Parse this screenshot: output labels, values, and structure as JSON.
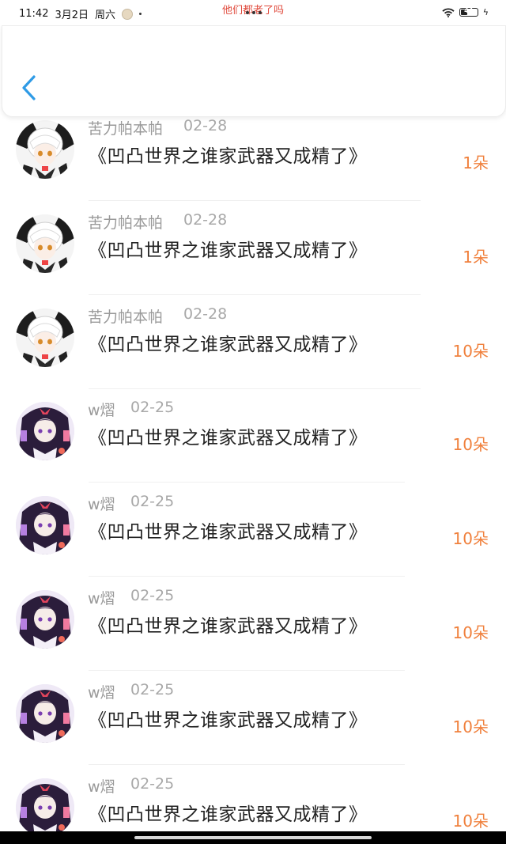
{
  "status_bar": {
    "time": "11:42",
    "date": "3月2日",
    "weekday": "周六",
    "notification_text": "他们都老了吗",
    "battery_level": "44"
  },
  "header": {
    "back_icon": "chevron-left-icon"
  },
  "items": [
    {
      "user": "苦力帕本帕",
      "date": "02-28",
      "title": "《凹凸世界之谁家武器又成精了》",
      "count": "1朵",
      "avatar": "white-hair"
    },
    {
      "user": "苦力帕本帕",
      "date": "02-28",
      "title": "《凹凸世界之谁家武器又成精了》",
      "count": "1朵",
      "avatar": "white-hair"
    },
    {
      "user": "苦力帕本帕",
      "date": "02-28",
      "title": "《凹凸世界之谁家武器又成精了》",
      "count": "10朵",
      "avatar": "white-hair"
    },
    {
      "user": "w熠",
      "date": "02-25",
      "title": "《凹凸世界之谁家武器又成精了》",
      "count": "10朵",
      "avatar": "purple-hair"
    },
    {
      "user": "w熠",
      "date": "02-25",
      "title": "《凹凸世界之谁家武器又成精了》",
      "count": "10朵",
      "avatar": "purple-hair"
    },
    {
      "user": "w熠",
      "date": "02-25",
      "title": "《凹凸世界之谁家武器又成精了》",
      "count": "10朵",
      "avatar": "purple-hair"
    },
    {
      "user": "w熠",
      "date": "02-25",
      "title": "《凹凸世界之谁家武器又成精了》",
      "count": "10朵",
      "avatar": "purple-hair"
    },
    {
      "user": "w熠",
      "date": "02-25",
      "title": "《凹凸世界之谁家武器又成精了》",
      "count": "10朵",
      "avatar": "purple-hair"
    }
  ],
  "colors": {
    "accent_orange": "#f0803c",
    "back_blue": "#2f9be6"
  }
}
